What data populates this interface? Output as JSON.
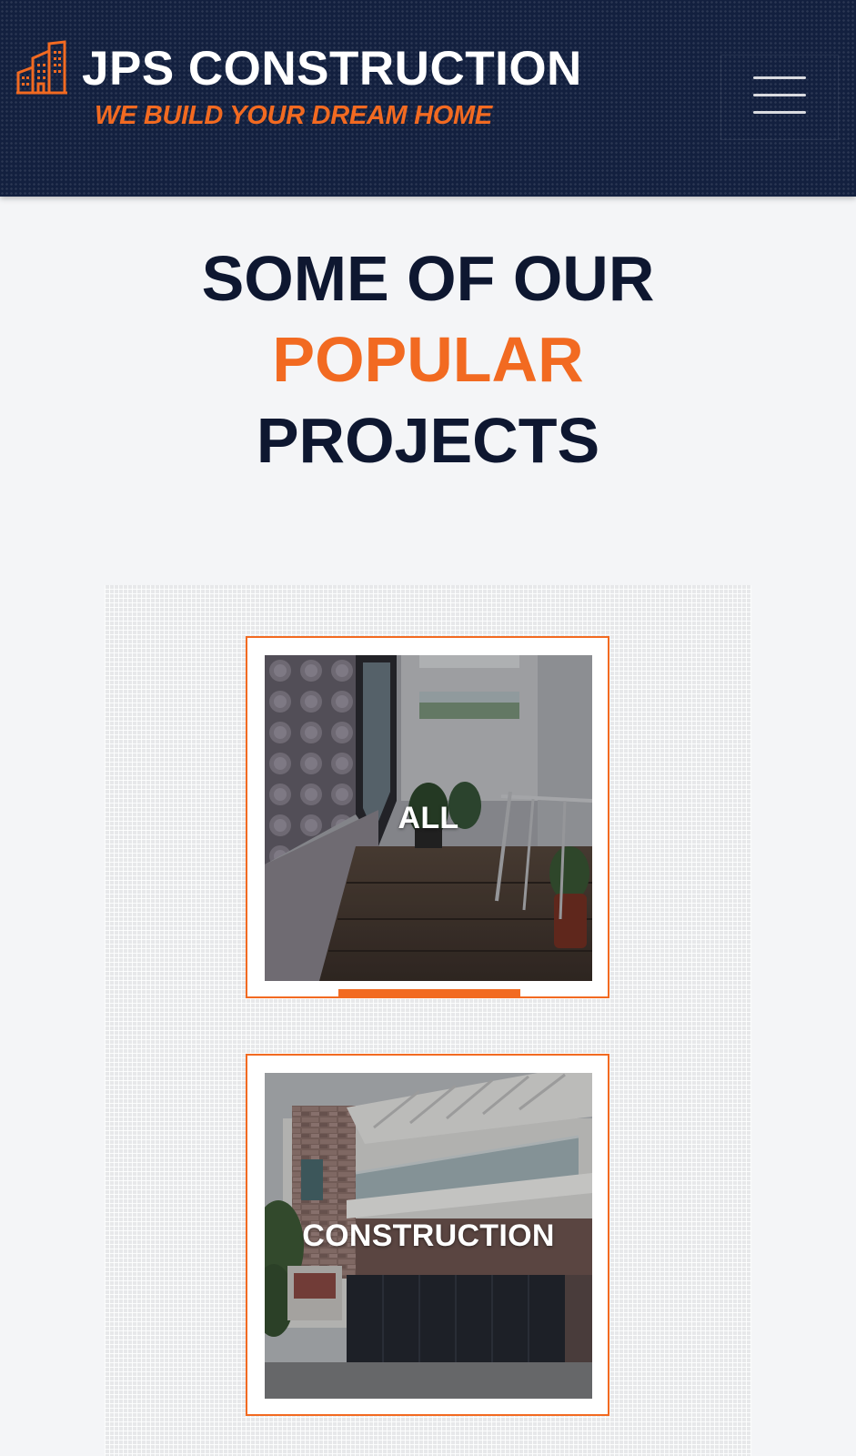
{
  "header": {
    "brand_title": "JPS CONSTRUCTION",
    "tagline": "WE BUILD YOUR DREAM HOME",
    "logo_icon": "building-icon",
    "menu_icon": "hamburger-menu-icon"
  },
  "section": {
    "heading_line1": "SOME OF OUR",
    "heading_accent": "POPULAR",
    "heading_line3": "PROJECTS"
  },
  "filters": [
    {
      "label": "ALL",
      "active": true,
      "photo": "interior-staircase-photo"
    },
    {
      "label": "CONSTRUCTION",
      "active": false,
      "photo": "house-exterior-photo"
    }
  ],
  "colors": {
    "navy": "#13203f",
    "heading": "#0e1730",
    "accent_orange": "#f26a21",
    "page_background": "#f4f5f7"
  }
}
